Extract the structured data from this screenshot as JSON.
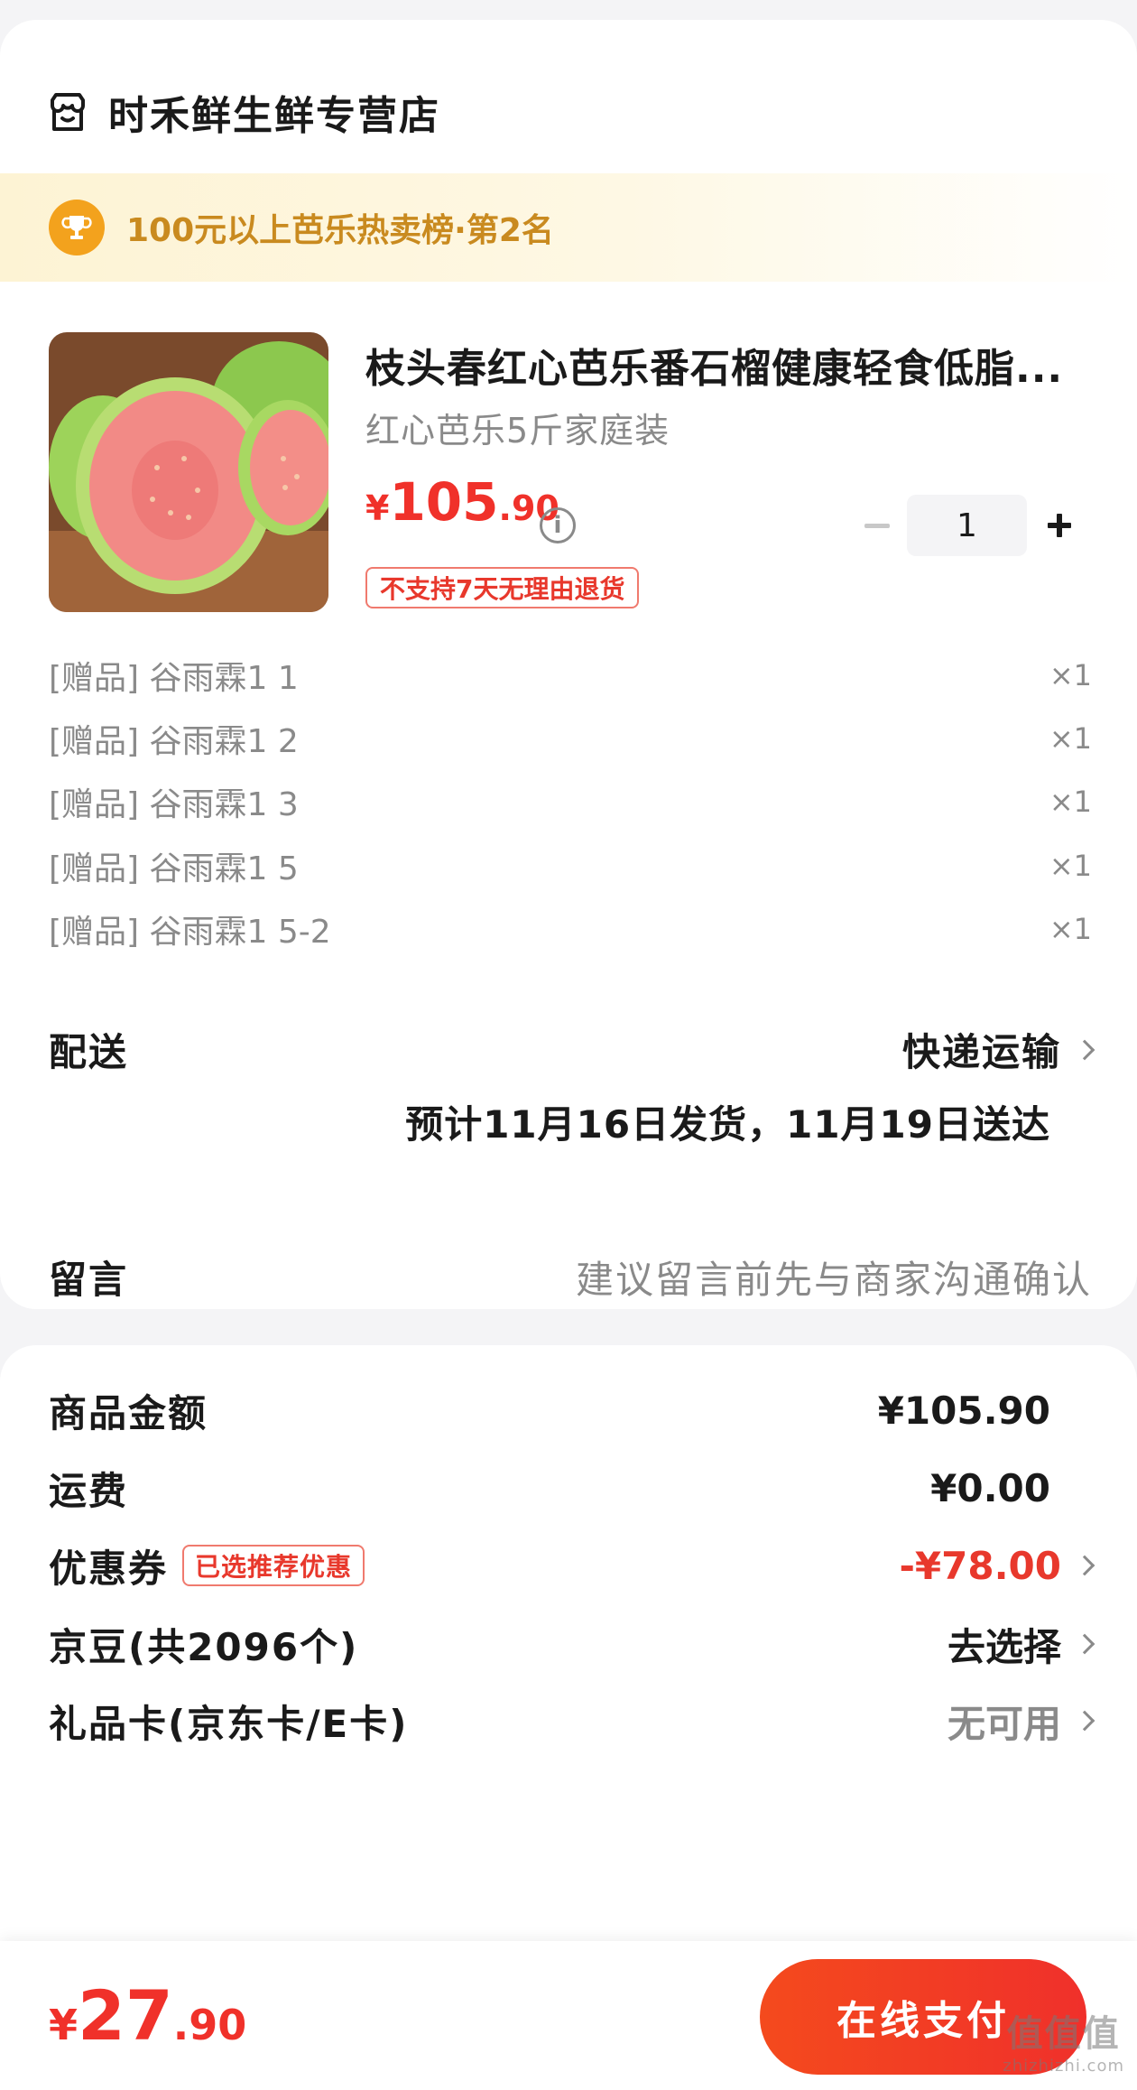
{
  "store": {
    "name": "时禾鲜生鲜专营店",
    "icon": "store-icon"
  },
  "ranking": {
    "text": "100元以上芭乐热卖榜·第2名",
    "icon": "trophy-icon"
  },
  "product": {
    "title": "枝头春红心芭乐番石榴健康轻食低脂...",
    "spec": "红心芭乐5斤家庭装",
    "price_symbol": "¥",
    "price_int": "105",
    "price_dec": ".90",
    "return_policy": "不支持7天无理由退货",
    "quantity": "1"
  },
  "gifts": [
    {
      "label": "[赠品] 谷雨霖1 1",
      "qty": "×1"
    },
    {
      "label": "[赠品] 谷雨霖1 2",
      "qty": "×1"
    },
    {
      "label": "[赠品] 谷雨霖1 3",
      "qty": "×1"
    },
    {
      "label": "[赠品] 谷雨霖1 5",
      "qty": "×1"
    },
    {
      "label": "[赠品] 谷雨霖1 5-2",
      "qty": "×1"
    }
  ],
  "delivery": {
    "label": "配送",
    "method": "快递运输",
    "estimate": "预计11月16日发货，11月19日送达"
  },
  "message": {
    "label": "留言",
    "placeholder": "建议留言前先与商家沟通确认"
  },
  "summary": {
    "goods_label": "商品金额",
    "goods_value": "¥105.90",
    "shipping_label": "运费",
    "shipping_value": "¥0.00",
    "coupon_label": "优惠券",
    "coupon_tag": "已选推荐优惠",
    "coupon_value": "-¥78.00",
    "jd_beans_label": "京豆(共2096个)",
    "jd_beans_value": "去选择",
    "giftcard_label": "礼品卡(京东卡/E卡)",
    "giftcard_value": "无可用"
  },
  "footer": {
    "total_symbol": "¥",
    "total_int": "27",
    "total_dec": ".90",
    "pay_label": "在线支付"
  },
  "watermark": {
    "line1": "值值值",
    "line2": "zhizhizhi.com"
  },
  "colors": {
    "accent_red": "#f0312a",
    "gold": "#c98a1f",
    "banner": "#fdf3d4"
  }
}
